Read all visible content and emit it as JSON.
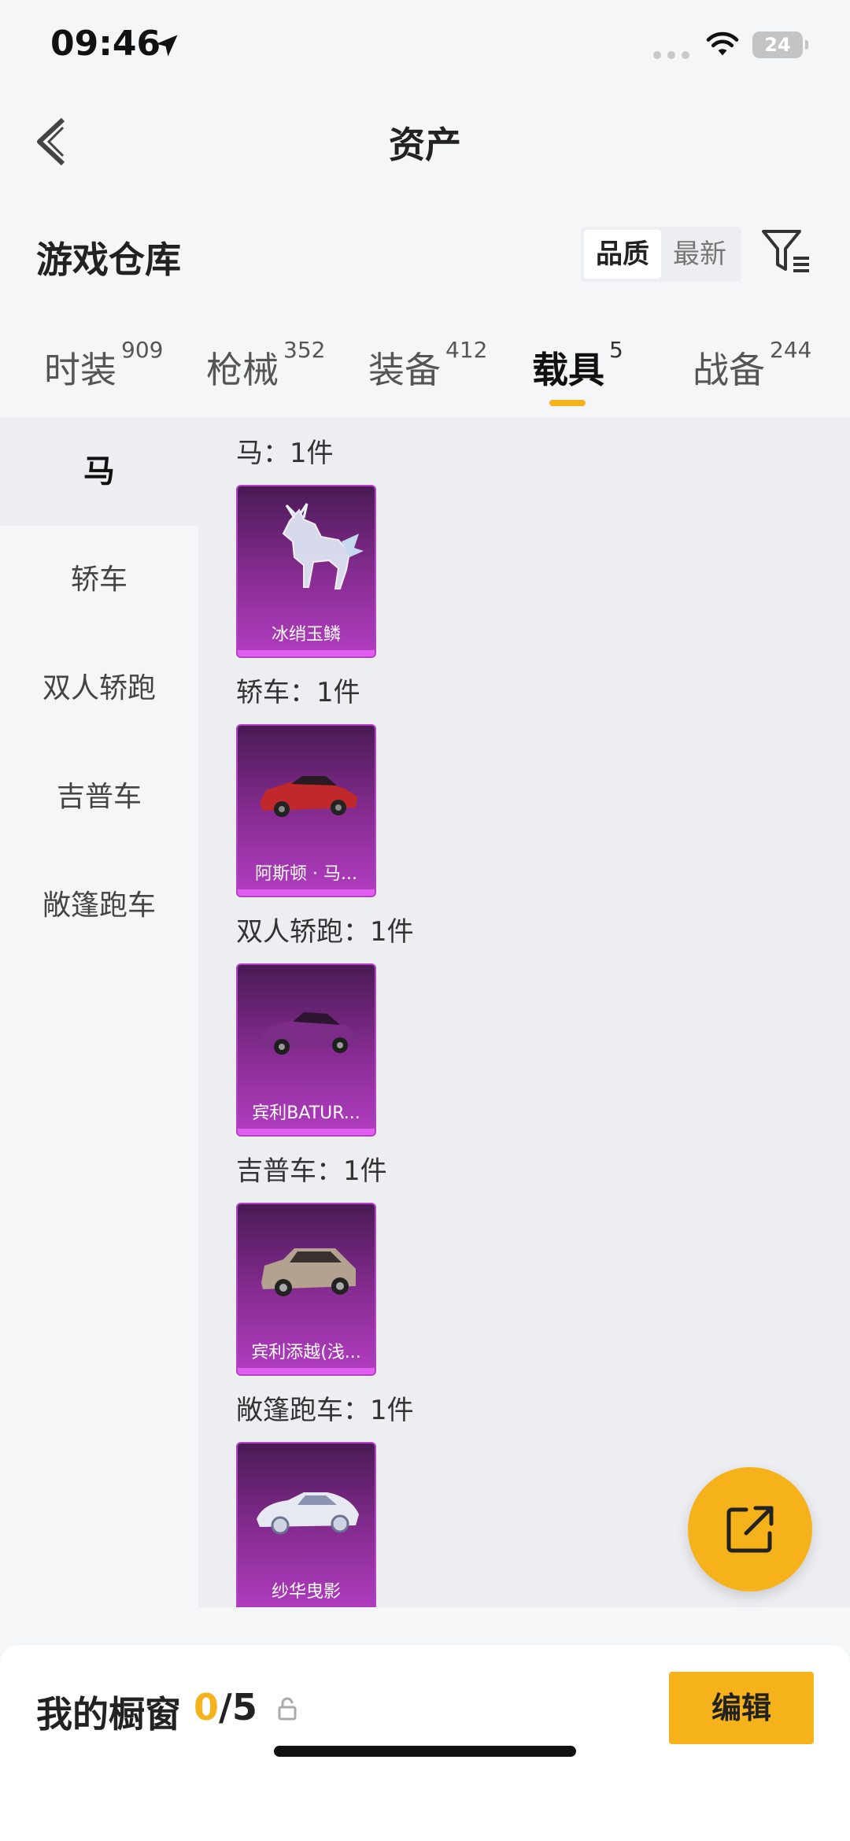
{
  "status_bar": {
    "time": "09:46",
    "battery": "24"
  },
  "header": {
    "title": "资产"
  },
  "warehouse": {
    "title": "游戏仓库",
    "sort_options": [
      "品质",
      "最新"
    ],
    "active_sort": "品质"
  },
  "tabs": [
    {
      "label": "时装",
      "count": "909"
    },
    {
      "label": "枪械",
      "count": "352"
    },
    {
      "label": "装备",
      "count": "412"
    },
    {
      "label": "载具",
      "count": "5",
      "active": true
    },
    {
      "label": "战备",
      "count": "244"
    }
  ],
  "sidebar": {
    "items": [
      {
        "label": "马",
        "active": true
      },
      {
        "label": "轿车"
      },
      {
        "label": "双人轿跑"
      },
      {
        "label": "吉普车"
      },
      {
        "label": "敞篷跑车"
      }
    ]
  },
  "groups": [
    {
      "title": "马：1件",
      "item": {
        "name": "冰绡玉鳞",
        "icon": "ice-horse-icon"
      }
    },
    {
      "title": "轿车：1件",
      "item": {
        "name": "阿斯顿 · 马...",
        "icon": "red-sports-car-icon"
      }
    },
    {
      "title": "双人轿跑：1件",
      "item": {
        "name": "宾利BATUR...",
        "icon": "purple-coupe-icon"
      }
    },
    {
      "title": "吉普车：1件",
      "item": {
        "name": "宾利添越(浅...",
        "icon": "suv-icon"
      }
    },
    {
      "title": "敞篷跑车：1件",
      "item": {
        "name": "纱华曳影",
        "icon": "white-convertible-icon"
      }
    }
  ],
  "bottom_bar": {
    "label": "我的橱窗",
    "current": "0",
    "total": "/5",
    "edit_label": "编辑"
  },
  "colors": {
    "accent": "#f6b21b",
    "card_purple": "#8a2d95"
  }
}
